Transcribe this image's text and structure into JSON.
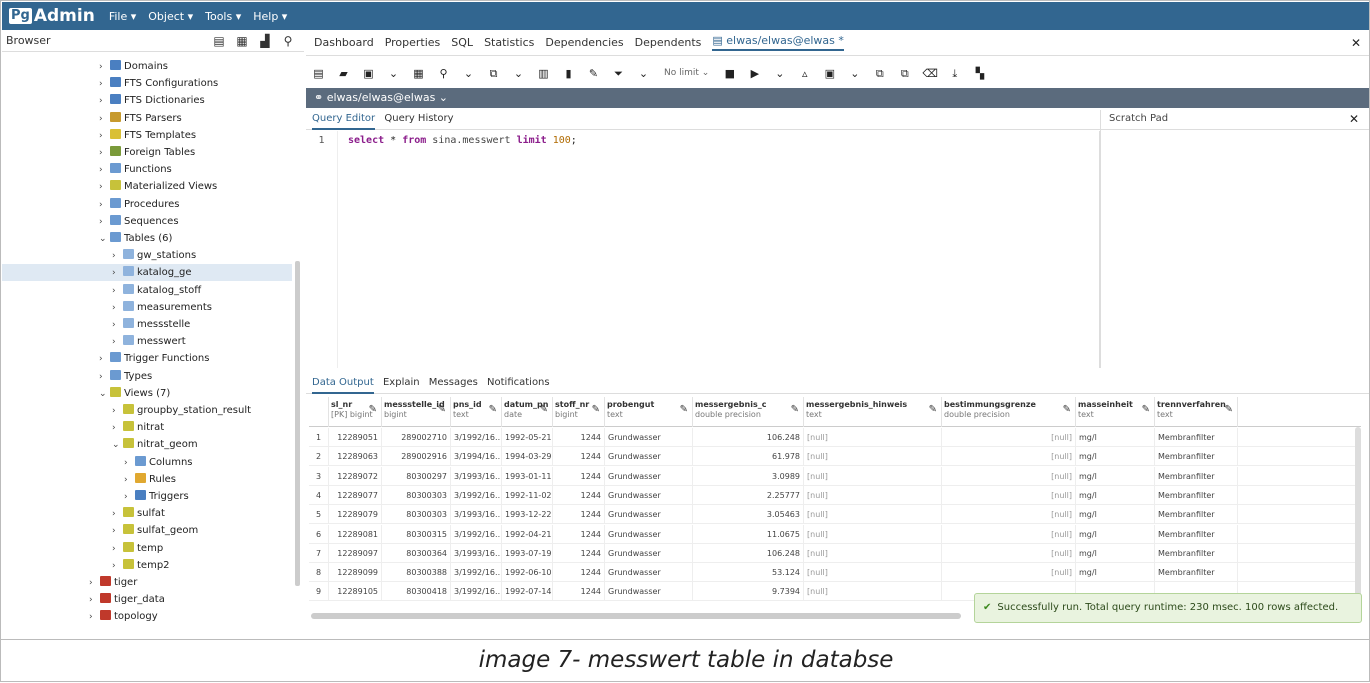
{
  "app": {
    "logo_pg": "Pg",
    "logo_admin": "Admin",
    "menu": [
      "File ▾",
      "Object ▾",
      "Tools ▾",
      "Help ▾"
    ]
  },
  "browser": {
    "title": "Browser"
  },
  "tree": [
    {
      "depth": 1,
      "chev": "›",
      "color": "#4a7fc1",
      "label": "Domains"
    },
    {
      "depth": 1,
      "chev": "›",
      "color": "#4a7fc1",
      "label": "FTS Configurations"
    },
    {
      "depth": 1,
      "chev": "›",
      "color": "#4a7fc1",
      "label": "FTS Dictionaries"
    },
    {
      "depth": 1,
      "chev": "›",
      "color": "#c79a2e",
      "label": "FTS Parsers"
    },
    {
      "depth": 1,
      "chev": "›",
      "color": "#d9c036",
      "label": "FTS Templates"
    },
    {
      "depth": 1,
      "chev": "›",
      "color": "#7a9a3a",
      "label": "Foreign Tables"
    },
    {
      "depth": 1,
      "chev": "›",
      "color": "#6b9ad1",
      "label": "Functions"
    },
    {
      "depth": 1,
      "chev": "›",
      "color": "#c7c23a",
      "label": "Materialized Views"
    },
    {
      "depth": 1,
      "chev": "›",
      "color": "#6b9ad1",
      "label": "Procedures"
    },
    {
      "depth": 1,
      "chev": "›",
      "color": "#6b9ad1",
      "label": "Sequences"
    },
    {
      "depth": 1,
      "chev": "⌄",
      "color": "#6b9ad1",
      "label": "Tables (6)"
    },
    {
      "depth": 2,
      "chev": "›",
      "color": "#8fb3dd",
      "label": "gw_stations"
    },
    {
      "depth": 2,
      "chev": "›",
      "color": "#8fb3dd",
      "label": "katalog_ge",
      "selected": true
    },
    {
      "depth": 2,
      "chev": "›",
      "color": "#8fb3dd",
      "label": "katalog_stoff"
    },
    {
      "depth": 2,
      "chev": "›",
      "color": "#8fb3dd",
      "label": "measurements"
    },
    {
      "depth": 2,
      "chev": "›",
      "color": "#8fb3dd",
      "label": "messstelle"
    },
    {
      "depth": 2,
      "chev": "›",
      "color": "#8fb3dd",
      "label": "messwert"
    },
    {
      "depth": 1,
      "chev": "›",
      "color": "#6b9ad1",
      "label": "Trigger Functions"
    },
    {
      "depth": 1,
      "chev": "›",
      "color": "#6b9ad1",
      "label": "Types"
    },
    {
      "depth": 1,
      "chev": "⌄",
      "color": "#c7c23a",
      "label": "Views (7)"
    },
    {
      "depth": 2,
      "chev": "›",
      "color": "#c7c23a",
      "label": "groupby_station_result"
    },
    {
      "depth": 2,
      "chev": "›",
      "color": "#c7c23a",
      "label": "nitrat"
    },
    {
      "depth": 2,
      "chev": "⌄",
      "color": "#c7c23a",
      "label": "nitrat_geom"
    },
    {
      "depth": 3,
      "chev": "›",
      "color": "#6b9ad1",
      "label": "Columns"
    },
    {
      "depth": 3,
      "chev": "›",
      "color": "#e0a830",
      "label": "Rules"
    },
    {
      "depth": 3,
      "chev": "›",
      "color": "#4a7fc1",
      "label": "Triggers"
    },
    {
      "depth": 2,
      "chev": "›",
      "color": "#c7c23a",
      "label": "sulfat"
    },
    {
      "depth": 2,
      "chev": "›",
      "color": "#c7c23a",
      "label": "sulfat_geom"
    },
    {
      "depth": 2,
      "chev": "›",
      "color": "#c7c23a",
      "label": "temp"
    },
    {
      "depth": 2,
      "chev": "›",
      "color": "#c7c23a",
      "label": "temp2"
    },
    {
      "depth": 0,
      "chev": "›",
      "color": "#c0392b",
      "label": "tiger"
    },
    {
      "depth": 0,
      "chev": "›",
      "color": "#c0392b",
      "label": "tiger_data"
    },
    {
      "depth": 0,
      "chev": "›",
      "color": "#c0392b",
      "label": "topology"
    }
  ],
  "tabs": [
    "Dashboard",
    "Properties",
    "SQL",
    "Statistics",
    "Dependencies",
    "Dependents"
  ],
  "active_tab": "elwas/elwas@elwas *",
  "toolbar": {
    "limit_label": "No limit"
  },
  "connection": "elwas/elwas@elwas ⌄",
  "query_tabs": [
    "Query Editor",
    "Query History"
  ],
  "scratch_title": "Scratch Pad",
  "editor": {
    "line_no": "1",
    "kw_select": "select",
    "star": " * ",
    "kw_from": "from",
    "table": " sina.messwert ",
    "kw_limit": "limit",
    "limit_val": "100",
    "semi": ";"
  },
  "output_tabs": [
    "Data Output",
    "Explain",
    "Messages",
    "Notifications"
  ],
  "columns": [
    {
      "name": "sl_nr",
      "type": "[PK] bigint"
    },
    {
      "name": "messstelle_id",
      "type": "bigint"
    },
    {
      "name": "pns_id",
      "type": "text"
    },
    {
      "name": "datum_pn",
      "type": "date"
    },
    {
      "name": "stoff_nr",
      "type": "bigint"
    },
    {
      "name": "probengut",
      "type": "text"
    },
    {
      "name": "messergebnis_c",
      "type": "double precision"
    },
    {
      "name": "messergebnis_hinweis",
      "type": "text"
    },
    {
      "name": "bestimmungsgrenze",
      "type": "double precision"
    },
    {
      "name": "masseinheit",
      "type": "text"
    },
    {
      "name": "trennverfahren",
      "type": "text"
    }
  ],
  "rows": [
    [
      "1",
      "12289051",
      "289002710",
      "3/1992/16...",
      "1992-05-21",
      "1244",
      "Grundwasser",
      "106.248",
      "[null]",
      "[null]",
      "mg/l",
      "Membranfilter"
    ],
    [
      "2",
      "12289063",
      "289002916",
      "3/1994/16...",
      "1994-03-29",
      "1244",
      "Grundwasser",
      "61.978",
      "[null]",
      "[null]",
      "mg/l",
      "Membranfilter"
    ],
    [
      "3",
      "12289072",
      "80300297",
      "3/1993/16...",
      "1993-01-11",
      "1244",
      "Grundwasser",
      "3.0989",
      "[null]",
      "[null]",
      "mg/l",
      "Membranfilter"
    ],
    [
      "4",
      "12289077",
      "80300303",
      "3/1992/16...",
      "1992-11-02",
      "1244",
      "Grundwasser",
      "2.25777",
      "[null]",
      "[null]",
      "mg/l",
      "Membranfilter"
    ],
    [
      "5",
      "12289079",
      "80300303",
      "3/1993/16...",
      "1993-12-22",
      "1244",
      "Grundwasser",
      "3.05463",
      "[null]",
      "[null]",
      "mg/l",
      "Membranfilter"
    ],
    [
      "6",
      "12289081",
      "80300315",
      "3/1992/16...",
      "1992-04-21",
      "1244",
      "Grundwasser",
      "11.0675",
      "[null]",
      "[null]",
      "mg/l",
      "Membranfilter"
    ],
    [
      "7",
      "12289097",
      "80300364",
      "3/1993/16...",
      "1993-07-19",
      "1244",
      "Grundwasser",
      "106.248",
      "[null]",
      "[null]",
      "mg/l",
      "Membranfilter"
    ],
    [
      "8",
      "12289099",
      "80300388",
      "3/1992/16...",
      "1992-06-10",
      "1244",
      "Grundwasser",
      "53.124",
      "[null]",
      "[null]",
      "mg/l",
      "Membranfilter"
    ],
    [
      "9",
      "12289105",
      "80300418",
      "3/1992/16...",
      "1992-07-14",
      "1244",
      "Grundwasser",
      "9.7394",
      "[null]",
      "",
      "",
      ""
    ]
  ],
  "toast": "Successfully run. Total query runtime: 230 msec. 100 rows affected.",
  "caption": "image 7- messwert table in databse"
}
